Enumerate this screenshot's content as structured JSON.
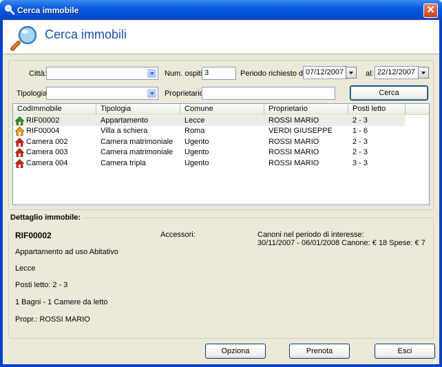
{
  "window": {
    "title": "Cerca immobile"
  },
  "header": {
    "title": "Cerca immobili"
  },
  "search": {
    "citta_label": "Città:",
    "citta_value": "",
    "ospiti_label": "Num. ospiti:",
    "ospiti_value": "3",
    "periodo_label": "Periodo richiesto dal:",
    "dal_value": "07/12/2007",
    "al_label": "al:",
    "al_value": "22/12/2007",
    "tipologia_label": "Tipologia:",
    "tipologia_value": "",
    "proprietario_label": "Proprietario:",
    "proprietario_value": "",
    "cerca_button": "Cerca"
  },
  "list": {
    "columns": [
      "CodImmobile",
      "Tipologia",
      "Comune",
      "Proprietario",
      "Posti letto"
    ],
    "rows": [
      {
        "cod": "RIF00002",
        "tipologia": "Appartamento",
        "comune": "Lecce",
        "proprietario": "ROSSI MARIO",
        "posti": "2 - 3",
        "icon": "house-green-icon",
        "color": "#2a9a2a"
      },
      {
        "cod": "RIF00004",
        "tipologia": "Villa a schiera",
        "comune": "Roma",
        "proprietario": "VERDI GIUSEPPE",
        "posti": "1 - 6",
        "icon": "house-orange-icon",
        "color": "#f0a020"
      },
      {
        "cod": "Camera 002",
        "tipologia": "Camera matrimoniale",
        "comune": "Ugento",
        "proprietario": "ROSSI MARIO",
        "posti": "2 - 3",
        "icon": "house-red-icon",
        "color": "#d02020"
      },
      {
        "cod": "Camera 003",
        "tipologia": "Camera matrimoniale",
        "comune": "Ugento",
        "proprietario": "ROSSI MARIO",
        "posti": "2 - 3",
        "icon": "house-red-icon",
        "color": "#d02020"
      },
      {
        "cod": "Camera 004",
        "tipologia": "Camera tripla",
        "comune": "Ugento",
        "proprietario": "ROSSI MARIO",
        "posti": "3 - 3",
        "icon": "house-red-icon",
        "color": "#d02020"
      }
    ]
  },
  "detail": {
    "legend": "Dettaglio immobile:",
    "code": "RIF00002",
    "description": "Appartamento ad uso Abitativo",
    "city": "Lecce",
    "posti": "Posti letto: 2 - 3",
    "rooms": "1 Bagni -  1 Camere da letto",
    "owner": "Propr.: ROSSI MARIO",
    "accessori_label": "Accessori:",
    "canoni_title": "Canoni nel periodo di interesse:",
    "canoni_line": "30/11/2007 - 06/01/2008 Canone: € 18 Spese: € 7"
  },
  "footer": {
    "opziona": "Opziona",
    "prenota": "Prenota",
    "esci": "Esci"
  }
}
